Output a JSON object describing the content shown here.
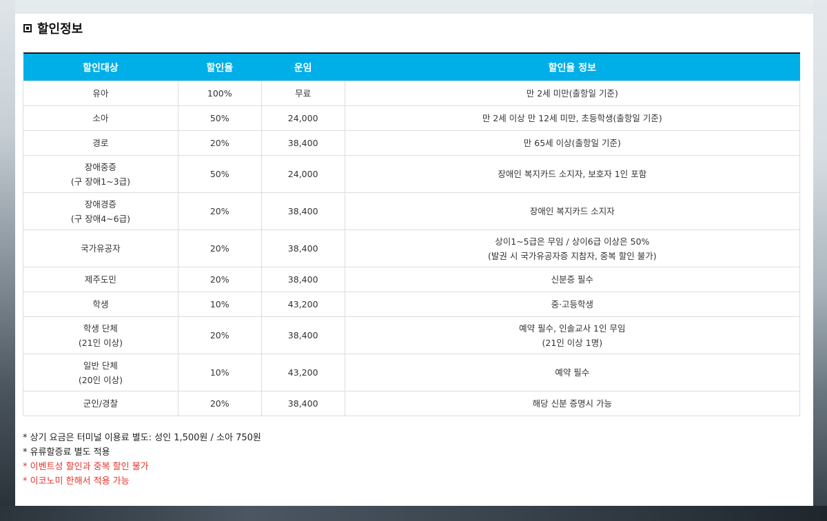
{
  "section": {
    "title": "할인정보",
    "icon": "square-bullet-icon"
  },
  "table": {
    "headers": [
      "할인대상",
      "할인율",
      "운임",
      "할인율 정보"
    ],
    "rows": [
      {
        "target": [
          "유아"
        ],
        "rate": "100%",
        "fare": "무료",
        "info": [
          "만 2세 미만(출항일 기준)"
        ]
      },
      {
        "target": [
          "소아"
        ],
        "rate": "50%",
        "fare": "24,000",
        "info": [
          "만 2세 이상 만 12세 미만, 초등학생(출항일 기준)"
        ]
      },
      {
        "target": [
          "경로"
        ],
        "rate": "20%",
        "fare": "38,400",
        "info": [
          "만 65세 이상(출항일 기준)"
        ]
      },
      {
        "target": [
          "장애중증",
          "(구 장애1~3급)"
        ],
        "rate": "50%",
        "fare": "24,000",
        "info": [
          "장애인 복지카드 소지자, 보호자 1인 포함"
        ]
      },
      {
        "target": [
          "장애경증",
          "(구 장애4~6급)"
        ],
        "rate": "20%",
        "fare": "38,400",
        "info": [
          "장애인 복지카드 소지자"
        ]
      },
      {
        "target": [
          "국가유공자"
        ],
        "rate": "20%",
        "fare": "38,400",
        "info": [
          "상이1~5급은 무임 / 상이6급 이상은 50%",
          "(발권 시 국가유공자증 지참자, 중복 할인 불가)"
        ]
      },
      {
        "target": [
          "제주도민"
        ],
        "rate": "20%",
        "fare": "38,400",
        "info": [
          "신분증 필수"
        ]
      },
      {
        "target": [
          "학생"
        ],
        "rate": "10%",
        "fare": "43,200",
        "info": [
          "중·고등학생"
        ]
      },
      {
        "target": [
          "학생 단체",
          "(21인 이상)"
        ],
        "rate": "20%",
        "fare": "38,400",
        "info": [
          "예약 필수, 인솔교사 1인 무임",
          "(21인 이상 1명)"
        ]
      },
      {
        "target": [
          "일반 단체",
          "(20인 이상)"
        ],
        "rate": "10%",
        "fare": "43,200",
        "info": [
          "예약 필수"
        ]
      },
      {
        "target": [
          "군인/경찰"
        ],
        "rate": "20%",
        "fare": "38,400",
        "info": [
          "해당 신분 증명시 가능"
        ]
      }
    ]
  },
  "notes": [
    {
      "text": "* 상기 요금은 터미널 이용료 별도: 성인 1,500원 / 소아 750원",
      "highlight": false
    },
    {
      "text": "* 유류할증료 별도 적용",
      "highlight": false
    },
    {
      "text": "* 이벤트성 할인과 중복 할인 불가",
      "highlight": true
    },
    {
      "text": "* 이코노미 한해서 적용 가능",
      "highlight": true
    }
  ],
  "colors": {
    "header_bg": "#00aee8",
    "header_text": "#ffffff",
    "note_highlight": "#e8322a"
  }
}
